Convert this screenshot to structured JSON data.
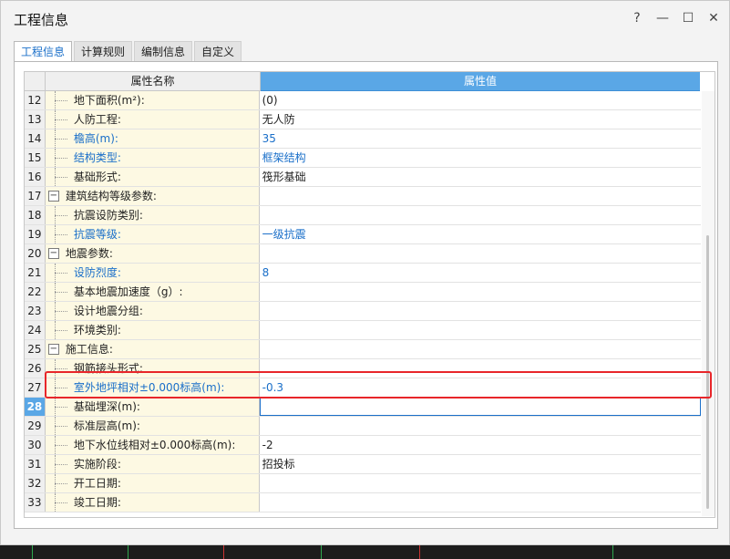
{
  "window": {
    "title": "工程信息",
    "controls": {
      "help": "?",
      "minimize": "—",
      "maximize": "☐",
      "close": "✕"
    }
  },
  "tabs": [
    {
      "label": "工程信息",
      "active": true
    },
    {
      "label": "计算规则",
      "active": false
    },
    {
      "label": "编制信息",
      "active": false
    },
    {
      "label": "自定义",
      "active": false
    }
  ],
  "grid": {
    "header": {
      "name": "属性名称",
      "value": "属性值"
    },
    "rows": [
      {
        "num": "12",
        "name": "地下面积(m²):",
        "value": "(0)",
        "type": "child",
        "blue": false
      },
      {
        "num": "13",
        "name": "人防工程:",
        "value": "无人防",
        "type": "child",
        "blue": false
      },
      {
        "num": "14",
        "name": "檐高(m):",
        "value": "35",
        "type": "child",
        "blue": true
      },
      {
        "num": "15",
        "name": "结构类型:",
        "value": "框架结构",
        "type": "child",
        "blue": true
      },
      {
        "num": "16",
        "name": "基础形式:",
        "value": "筏形基础",
        "type": "child",
        "blue": false
      },
      {
        "num": "17",
        "name": "建筑结构等级参数:",
        "value": "",
        "type": "group",
        "blue": false
      },
      {
        "num": "18",
        "name": "抗震设防类别:",
        "value": "",
        "type": "child",
        "blue": false
      },
      {
        "num": "19",
        "name": "抗震等级:",
        "value": "一级抗震",
        "type": "child",
        "blue": true
      },
      {
        "num": "20",
        "name": "地震参数:",
        "value": "",
        "type": "group",
        "blue": false
      },
      {
        "num": "21",
        "name": "设防烈度:",
        "value": "8",
        "type": "child",
        "blue": true
      },
      {
        "num": "22",
        "name": "基本地震加速度（g）:",
        "value": "",
        "type": "child",
        "blue": false
      },
      {
        "num": "23",
        "name": "设计地震分组:",
        "value": "",
        "type": "child",
        "blue": false
      },
      {
        "num": "24",
        "name": "环境类别:",
        "value": "",
        "type": "child",
        "blue": false
      },
      {
        "num": "25",
        "name": "施工信息:",
        "value": "",
        "type": "group",
        "blue": false
      },
      {
        "num": "26",
        "name": "钢筋接头形式:",
        "value": "",
        "type": "child",
        "blue": false
      },
      {
        "num": "27",
        "name": "室外地坪相对±0.000标高(m):",
        "value": "-0.3",
        "type": "child",
        "blue": true
      },
      {
        "num": "28",
        "name": "基础埋深(m):",
        "value": "",
        "type": "child",
        "blue": false,
        "current": true
      },
      {
        "num": "29",
        "name": "标准层高(m):",
        "value": "",
        "type": "child",
        "blue": false
      },
      {
        "num": "30",
        "name": "地下水位线相对±0.000标高(m):",
        "value": "-2",
        "type": "child",
        "blue": false
      },
      {
        "num": "31",
        "name": "实施阶段:",
        "value": "招投标",
        "type": "child",
        "blue": false
      },
      {
        "num": "32",
        "name": "开工日期:",
        "value": "",
        "type": "child",
        "blue": false
      },
      {
        "num": "33",
        "name": "竣工日期:",
        "value": "",
        "type": "child",
        "blue": false
      }
    ]
  },
  "colors": {
    "accent": "#1a6fc9",
    "header_value_bg": "#5aa7e6",
    "name_cell_bg": "#fdf9e3",
    "highlight_box": "#e8262a"
  },
  "group_toggle_symbol": "−"
}
